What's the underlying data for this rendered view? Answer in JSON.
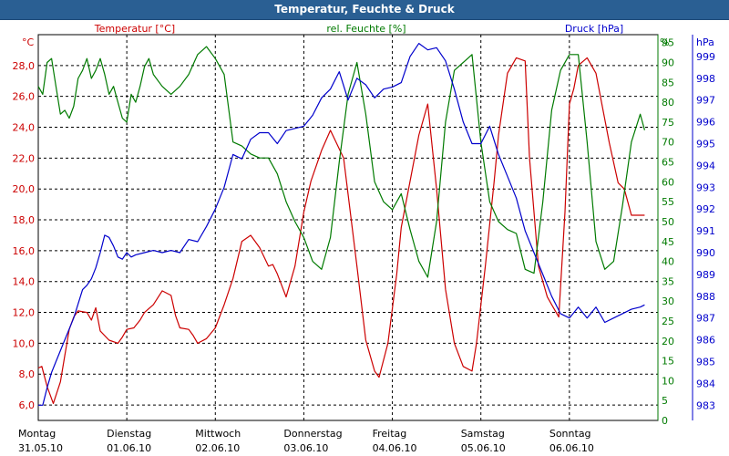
{
  "window": {
    "title": "Temperatur, Feuchte & Druck"
  },
  "chart_data": {
    "type": "line",
    "title": "Temperatur, Feuchte & Druck",
    "x_start": "31.05.10",
    "x_end": "07.06.10",
    "x_categories": [
      {
        "day": "Montag",
        "date": "31.05.10"
      },
      {
        "day": "Dienstag",
        "date": "01.06.10"
      },
      {
        "day": "Mittwoch",
        "date": "02.06.10"
      },
      {
        "day": "Donnerstag",
        "date": "03.06.10"
      },
      {
        "day": "Freitag",
        "date": "04.06.10"
      },
      {
        "day": "Samstag",
        "date": "05.06.10"
      },
      {
        "day": "Sonntag",
        "date": "06.06.10"
      }
    ],
    "grid": true,
    "axes": {
      "temperature": {
        "label": "Temperatur [°C]",
        "unit": "°C",
        "side": "left",
        "min": 5.0,
        "max": 30.0,
        "ticks": [
          "6,0",
          "8,0",
          "10,0",
          "12,0",
          "14,0",
          "16,0",
          "18,0",
          "20,0",
          "22,0",
          "24,0",
          "26,0",
          "28,0"
        ],
        "tick_values": [
          6,
          8,
          10,
          12,
          14,
          16,
          18,
          20,
          22,
          24,
          26,
          28
        ],
        "color": "#cc0000"
      },
      "humidity": {
        "label": "rel. Feuchte [%]",
        "unit": "%",
        "side": "right",
        "min": 0,
        "max": 97,
        "ticks": [
          "0",
          "5",
          "10",
          "15",
          "20",
          "25",
          "30",
          "35",
          "40",
          "45",
          "50",
          "55",
          "60",
          "65",
          "70",
          "75",
          "80",
          "85",
          "90",
          "95"
        ],
        "tick_values": [
          0,
          5,
          10,
          15,
          20,
          25,
          30,
          35,
          40,
          45,
          50,
          55,
          60,
          65,
          70,
          75,
          80,
          85,
          90,
          95
        ],
        "color": "#007a00"
      },
      "pressure": {
        "label": "Druck [hPa]",
        "unit": "hPa",
        "side": "right",
        "min": 982.3,
        "max": 1000.0,
        "ticks": [
          "983",
          "984",
          "985",
          "986",
          "987",
          "988",
          "989",
          "990",
          "991",
          "992",
          "993",
          "994",
          "995",
          "996",
          "997",
          "998",
          "999"
        ],
        "tick_values": [
          983,
          984,
          985,
          986,
          987,
          988,
          989,
          990,
          991,
          992,
          993,
          994,
          995,
          996,
          997,
          998,
          999
        ],
        "color": "#0000cc"
      }
    },
    "series": [
      {
        "name": "Temperatur [°C]",
        "axis": "temperature",
        "color": "#cc0000",
        "x": [
          0,
          0.04,
          0.1,
          0.17,
          0.25,
          0.3,
          0.35,
          0.4,
          0.45,
          0.55,
          0.6,
          0.65,
          0.7,
          0.8,
          0.9,
          0.95,
          1.0,
          1.08,
          1.15,
          1.2,
          1.3,
          1.4,
          1.5,
          1.55,
          1.6,
          1.7,
          1.75,
          1.8,
          1.9,
          2.0,
          2.1,
          2.2,
          2.3,
          2.4,
          2.5,
          2.6,
          2.65,
          2.7,
          2.8,
          2.9,
          3.0,
          3.08,
          3.2,
          3.3,
          3.45,
          3.6,
          3.7,
          3.8,
          3.85,
          3.95,
          4.05,
          4.1,
          4.2,
          4.3,
          4.4,
          4.5,
          4.6,
          4.7,
          4.8,
          4.9,
          4.95,
          5.05,
          5.15,
          5.2,
          5.3,
          5.4,
          5.5,
          5.55,
          5.65,
          5.75,
          5.8,
          5.88,
          5.95,
          6.0,
          6.05,
          6.1,
          6.2,
          6.3,
          6.45,
          6.55,
          6.62,
          6.7,
          6.75,
          6.8,
          6.85
        ],
        "y": [
          8.4,
          8.5,
          7.2,
          6.1,
          7.5,
          9.2,
          10.9,
          11.7,
          12.1,
          12.0,
          11.5,
          12.3,
          10.8,
          10.2,
          10.0,
          10.4,
          10.9,
          11.0,
          11.5,
          12.0,
          12.5,
          13.4,
          13.1,
          11.8,
          11.0,
          10.9,
          10.5,
          10.0,
          10.3,
          11.0,
          12.5,
          14.2,
          16.6,
          17.0,
          16.2,
          15.0,
          15.1,
          14.5,
          13.0,
          15.0,
          18.5,
          20.5,
          22.5,
          23.8,
          22.0,
          15.0,
          10.2,
          8.2,
          7.8,
          10.0,
          14.5,
          17.5,
          20.5,
          23.5,
          25.5,
          20.0,
          13.5,
          10.0,
          8.5,
          8.2,
          10.0,
          15.0,
          20.5,
          23.5,
          27.5,
          28.5,
          28.3,
          22.0,
          15.0,
          13.0,
          12.5,
          11.7,
          18.5,
          25.5,
          26.5,
          28.0,
          28.5,
          27.5,
          23.0,
          20.4,
          20.0,
          18.3,
          18.3,
          18.3,
          18.3
        ]
      },
      {
        "name": "rel. Feuchte [%]",
        "axis": "humidity",
        "color": "#007a00",
        "x": [
          0,
          0.05,
          0.1,
          0.15,
          0.2,
          0.25,
          0.3,
          0.35,
          0.4,
          0.45,
          0.5,
          0.55,
          0.6,
          0.65,
          0.7,
          0.75,
          0.8,
          0.85,
          0.9,
          0.95,
          1.0,
          1.05,
          1.1,
          1.15,
          1.2,
          1.25,
          1.3,
          1.4,
          1.5,
          1.6,
          1.7,
          1.8,
          1.9,
          2.0,
          2.1,
          2.2,
          2.3,
          2.4,
          2.5,
          2.6,
          2.7,
          2.8,
          2.9,
          3.0,
          3.1,
          3.2,
          3.3,
          3.4,
          3.5,
          3.6,
          3.7,
          3.8,
          3.9,
          4.0,
          4.1,
          4.2,
          4.3,
          4.4,
          4.5,
          4.6,
          4.7,
          4.8,
          4.9,
          5.0,
          5.1,
          5.2,
          5.3,
          5.4,
          5.5,
          5.6,
          5.7,
          5.8,
          5.9,
          6.0,
          6.1,
          6.2,
          6.3,
          6.4,
          6.5,
          6.6,
          6.7,
          6.8,
          6.85
        ],
        "y": [
          84,
          82,
          90,
          91,
          84,
          77,
          78,
          76,
          79,
          86,
          88,
          91,
          86,
          88,
          91,
          87,
          82,
          84,
          80,
          76,
          75,
          82,
          80,
          84,
          89,
          91,
          87,
          84,
          82,
          84,
          87,
          92,
          94,
          91,
          87,
          70,
          69,
          67,
          66,
          66,
          62,
          55,
          50,
          46,
          40,
          38,
          46,
          65,
          82,
          90,
          77,
          60,
          55,
          53,
          57,
          48,
          40,
          36,
          50,
          75,
          88,
          90,
          92,
          70,
          55,
          50,
          48,
          47,
          38,
          37,
          55,
          78,
          88,
          92,
          92,
          70,
          45,
          38,
          40,
          54,
          70,
          77,
          73
        ]
      },
      {
        "name": "Druck [hPa]",
        "axis": "pressure",
        "color": "#0000cc",
        "x": [
          0,
          0.05,
          0.1,
          0.15,
          0.2,
          0.3,
          0.4,
          0.5,
          0.55,
          0.6,
          0.65,
          0.7,
          0.75,
          0.8,
          0.85,
          0.9,
          0.95,
          1.0,
          1.05,
          1.1,
          1.2,
          1.3,
          1.4,
          1.5,
          1.6,
          1.7,
          1.8,
          1.9,
          2.0,
          2.1,
          2.2,
          2.3,
          2.4,
          2.5,
          2.6,
          2.7,
          2.8,
          2.9,
          3.0,
          3.1,
          3.2,
          3.3,
          3.4,
          3.5,
          3.6,
          3.7,
          3.8,
          3.9,
          4.0,
          4.1,
          4.2,
          4.3,
          4.4,
          4.5,
          4.6,
          4.7,
          4.8,
          4.9,
          5.0,
          5.1,
          5.2,
          5.3,
          5.4,
          5.5,
          5.6,
          5.7,
          5.8,
          5.9,
          6.0,
          6.1,
          6.2,
          6.3,
          6.4,
          6.5,
          6.6,
          6.7,
          6.8,
          6.85
        ],
        "y": [
          983.0,
          983.0,
          983.8,
          984.5,
          985.0,
          986.0,
          987.0,
          988.3,
          988.5,
          988.8,
          989.3,
          990.0,
          990.8,
          990.7,
          990.3,
          989.8,
          989.7,
          990.0,
          989.8,
          989.9,
          990.0,
          990.1,
          990.0,
          990.1,
          990.0,
          990.6,
          990.5,
          991.2,
          992.0,
          993.0,
          994.5,
          994.3,
          995.2,
          995.5,
          995.5,
          995.0,
          995.6,
          995.7,
          995.8,
          996.3,
          997.1,
          997.5,
          998.3,
          997.0,
          998.0,
          997.7,
          997.1,
          997.5,
          997.6,
          997.8,
          999.0,
          999.6,
          999.3,
          999.4,
          998.8,
          997.5,
          996.0,
          995.0,
          995.0,
          995.8,
          994.5,
          993.5,
          992.5,
          991.0,
          990.0,
          989.0,
          988.0,
          987.2,
          987.0,
          987.5,
          987.0,
          987.5,
          986.8,
          987.0,
          987.2,
          987.4,
          987.5,
          987.6
        ]
      }
    ]
  }
}
